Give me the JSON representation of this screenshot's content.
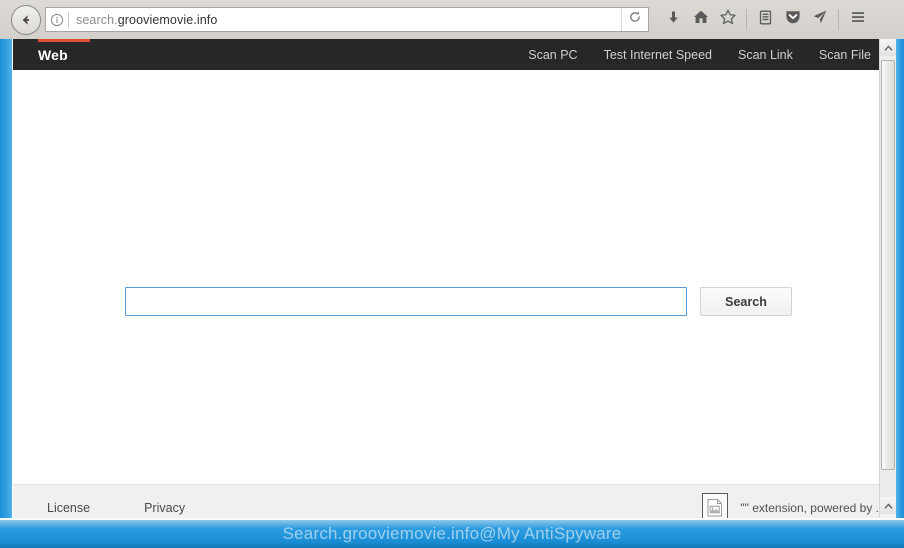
{
  "browser": {
    "url_prefix": "search.",
    "url_domain": "grooviemovie.info",
    "url_full": "search.grooviemovie.info",
    "back_icon": "back-arrow-icon",
    "info_icon": "info-circle-icon",
    "reload_icon": "reload-icon",
    "toolbar_icons": [
      {
        "name": "downloads-icon",
        "label": "Downloads"
      },
      {
        "name": "home-icon",
        "label": "Home"
      },
      {
        "name": "bookmark-star-icon",
        "label": "Bookmark"
      },
      {
        "name": "library-icon",
        "label": "Library"
      },
      {
        "name": "pocket-icon",
        "label": "Save to Pocket"
      },
      {
        "name": "send-tab-icon",
        "label": "Send Tab"
      },
      {
        "name": "hamburger-menu-icon",
        "label": "Open menu"
      }
    ]
  },
  "site": {
    "nav": {
      "tab_label": "Web",
      "accent_color": "#e04f34",
      "background_color": "#272727",
      "links": [
        "Scan PC",
        "Test Internet Speed",
        "Scan Link",
        "Scan File"
      ]
    },
    "search": {
      "value": "",
      "placeholder": "",
      "button_label": "Search",
      "border_color": "#5b9bd5"
    },
    "footer": {
      "links": [
        "License",
        "Privacy"
      ],
      "extension_icon": "broken-image-icon",
      "extension_text": "\"\" extension, powered by ."
    }
  },
  "watermark": {
    "text": "Search.grooviemovie.info@My AntiSpyware"
  },
  "scrollbar": {
    "up_arrow": "scroll-up-arrow-icon",
    "down_arrow": "scroll-down-arrow-icon"
  }
}
